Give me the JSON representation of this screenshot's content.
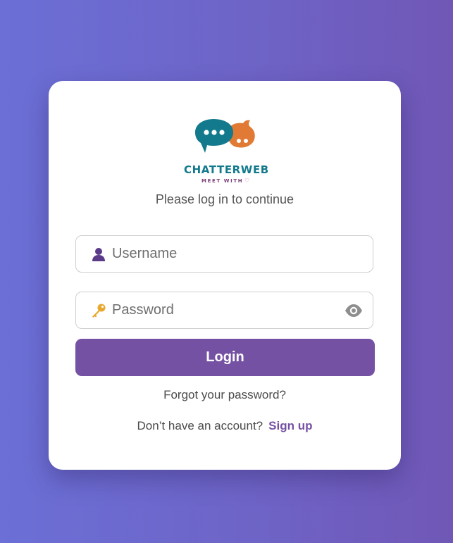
{
  "brand": {
    "name": "CHATTERWEB",
    "tagline": "MEET WITH",
    "tagline_icon": "heart-icon",
    "colors": {
      "teal": "#127a8c",
      "orange": "#e07a34",
      "purple": "#7551a4"
    }
  },
  "login_form": {
    "subtitle": "Please log in to continue",
    "username": {
      "icon": "user-icon",
      "placeholder": "Username",
      "value": ""
    },
    "password": {
      "icon": "key-icon",
      "placeholder": "Password",
      "value": "",
      "toggle_icon": "eye-icon"
    },
    "login_label": "Login",
    "forgot_label": "Forgot your password?",
    "signup_prompt": "Don’t have an account?",
    "signup_label": "Sign up"
  },
  "theme": {
    "background_gradient": [
      "#6b6fd6",
      "#7057b6"
    ],
    "button_color": "#7551a4"
  }
}
